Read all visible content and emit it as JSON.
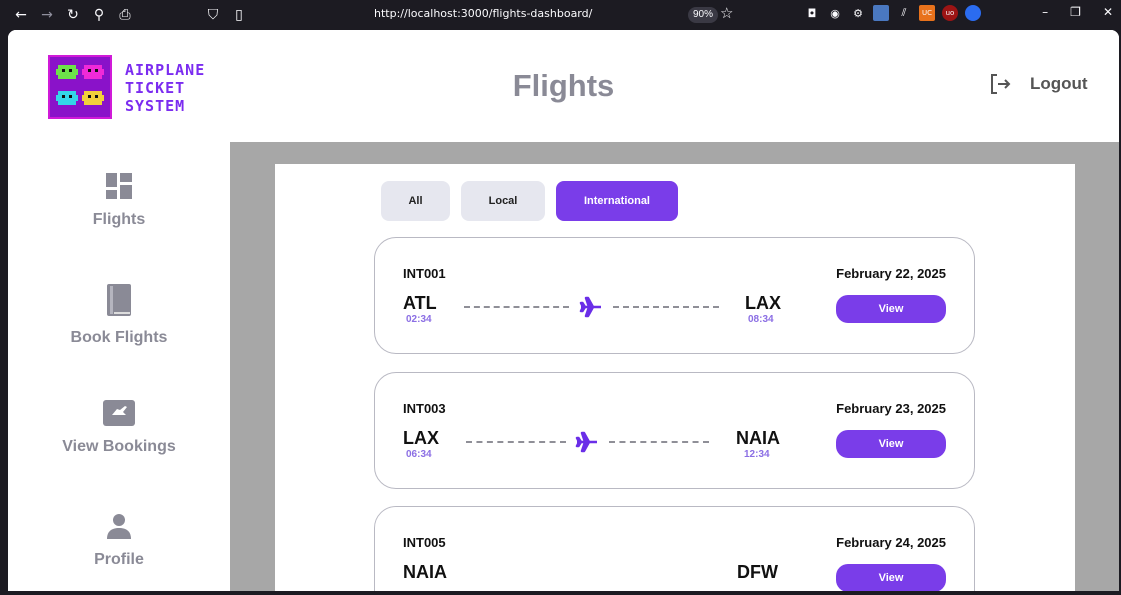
{
  "browser": {
    "url": "http://localhost:3000/flights-dashboard/",
    "zoom": "90%"
  },
  "header": {
    "logo_lines": [
      "AIRPLANE",
      "TICKET",
      "SYSTEM"
    ],
    "title": "Flights",
    "logout_label": "Logout"
  },
  "sidebar": {
    "items": [
      {
        "label": "Flights",
        "icon": "dashboard-icon"
      },
      {
        "label": "Book Flights",
        "icon": "book-icon"
      },
      {
        "label": "View Bookings",
        "icon": "ticket-icon"
      },
      {
        "label": "Profile",
        "icon": "user-icon"
      }
    ]
  },
  "tabs": [
    {
      "label": "All",
      "active": false
    },
    {
      "label": "Local",
      "active": false
    },
    {
      "label": "International",
      "active": true
    }
  ],
  "flights": [
    {
      "id": "INT001",
      "date": "February 22, 2025",
      "from": "ATL",
      "from_time": "02:34",
      "to": "LAX",
      "to_time": "08:34",
      "action": "View"
    },
    {
      "id": "INT003",
      "date": "February 23, 2025",
      "from": "LAX",
      "from_time": "06:34",
      "to": "NAIA",
      "to_time": "12:34",
      "action": "View"
    },
    {
      "id": "INT005",
      "date": "February 24, 2025",
      "from": "NAIA",
      "from_time": "",
      "to": "DFW",
      "to_time": "",
      "action": "View"
    }
  ],
  "colors": {
    "accent": "#7a3de9",
    "muted_text": "#8a8a96",
    "content_bg": "#a7a7a7"
  }
}
